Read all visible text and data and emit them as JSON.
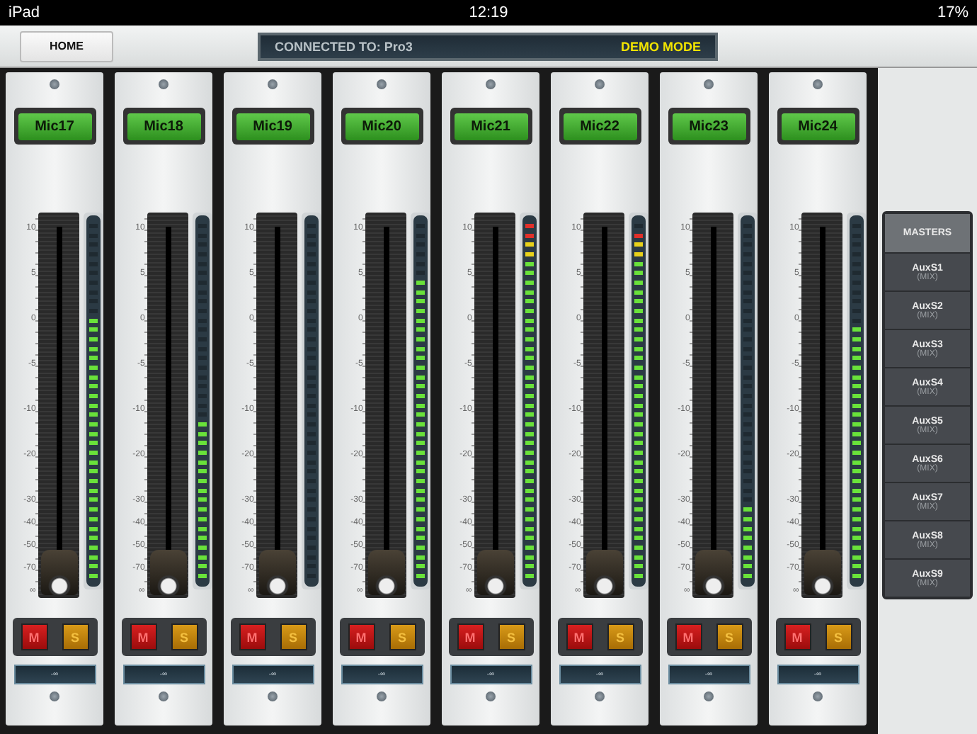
{
  "status_bar": {
    "device": "iPad",
    "time": "12:19",
    "battery": "17%"
  },
  "header": {
    "home": "HOME",
    "connection": "CONNECTED TO: Pro3",
    "mode": "DEMO MODE"
  },
  "channels": [
    {
      "name": "Mic17",
      "scale": [
        "10",
        "5",
        "0",
        "-5",
        "-10",
        "-20",
        "-30",
        "-40",
        "-50",
        "-70",
        "∞"
      ],
      "meter": {
        "level": 0.73
      },
      "fader": {
        "level": 0
      },
      "mute": "M",
      "solo": "S",
      "readout": "-∞"
    },
    {
      "name": "Mic18",
      "scale": [
        "10",
        "5",
        "0",
        "-5",
        "-10",
        "-20",
        "-30",
        "-40",
        "-50",
        "-70",
        "∞"
      ],
      "meter": {
        "level": 0.44
      },
      "fader": {
        "level": 0
      },
      "mute": "M",
      "solo": "S",
      "readout": "-∞"
    },
    {
      "name": "Mic19",
      "scale": [
        "10",
        "5",
        "0",
        "-5",
        "-10",
        "-20",
        "-30",
        "-40",
        "-50",
        "-70",
        "∞"
      ],
      "meter": {
        "level": 0
      },
      "fader": {
        "level": 0
      },
      "mute": "M",
      "solo": "S",
      "readout": "-∞"
    },
    {
      "name": "Mic20",
      "scale": [
        "10",
        "5",
        "0",
        "-5",
        "-10",
        "-20",
        "-30",
        "-40",
        "-50",
        "-70",
        "∞"
      ],
      "meter": {
        "level": 0.83
      },
      "fader": {
        "level": 0
      },
      "mute": "M",
      "solo": "S",
      "readout": "-∞"
    },
    {
      "name": "Mic21",
      "scale": [
        "10",
        "5",
        "0",
        "-5",
        "-10",
        "-20",
        "-30",
        "-40",
        "-50",
        "-70",
        "∞"
      ],
      "meter": {
        "level": 1
      },
      "fader": {
        "level": 0
      },
      "mute": "M",
      "solo": "S",
      "readout": "-∞"
    },
    {
      "name": "Mic22",
      "scale": [
        "10",
        "5",
        "0",
        "-5",
        "-10",
        "-20",
        "-30",
        "-40",
        "-50",
        "-70",
        "∞"
      ],
      "meter": {
        "level": 0.98
      },
      "fader": {
        "level": 0
      },
      "mute": "M",
      "solo": "S",
      "readout": "-∞"
    },
    {
      "name": "Mic23",
      "scale": [
        "10",
        "5",
        "0",
        "-5",
        "-10",
        "-20",
        "-30",
        "-40",
        "-50",
        "-70",
        "∞"
      ],
      "meter": {
        "level": 0.22
      },
      "fader": {
        "level": 0
      },
      "mute": "M",
      "solo": "S",
      "readout": "-∞"
    },
    {
      "name": "Mic24",
      "scale": [
        "10",
        "5",
        "0",
        "-5",
        "-10",
        "-20",
        "-30",
        "-40",
        "-50",
        "-70",
        "∞"
      ],
      "meter": {
        "level": 0.72
      },
      "fader": {
        "level": 0
      },
      "mute": "M",
      "solo": "S",
      "readout": "-∞"
    }
  ],
  "masters": {
    "title": "MASTERS",
    "items": [
      {
        "name": "AuxS1",
        "type": "(MIX)"
      },
      {
        "name": "AuxS2",
        "type": "(MIX)"
      },
      {
        "name": "AuxS3",
        "type": "(MIX)"
      },
      {
        "name": "AuxS4",
        "type": "(MIX)"
      },
      {
        "name": "AuxS5",
        "type": "(MIX)"
      },
      {
        "name": "AuxS6",
        "type": "(MIX)"
      },
      {
        "name": "AuxS7",
        "type": "(MIX)"
      },
      {
        "name": "AuxS8",
        "type": "(MIX)"
      },
      {
        "name": "AuxS9",
        "type": "(MIX)"
      }
    ]
  }
}
